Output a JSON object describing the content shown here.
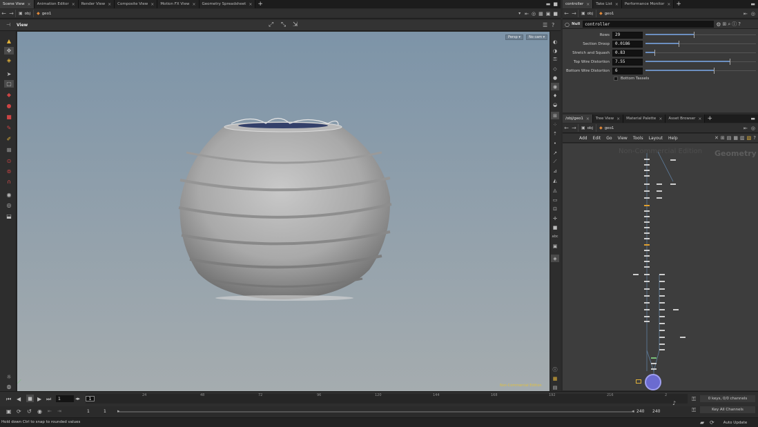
{
  "top_tabs_left": [
    "Scene View",
    "Animation Editor",
    "Render View",
    "Composite View",
    "Motion FX View",
    "Geometry Spreadsheet"
  ],
  "top_tabs_right": [
    "controller",
    "Take List",
    "Performance Monitor"
  ],
  "tab_plus": "+",
  "tab_close": "×",
  "path_left": {
    "obj": "obj",
    "geo": "geo1"
  },
  "path_right": {
    "obj": "obj",
    "geo": "geo1"
  },
  "viewport": {
    "title": "View",
    "persp": "Persp ▾",
    "cam": "No cam ▾",
    "watermark": "Non-Commercial Edition"
  },
  "parm_panel": {
    "node_type": "Null",
    "node_name": "controller",
    "params": [
      {
        "label": "Rows",
        "value": "29",
        "fill": 0.44
      },
      {
        "label": "Section Droop",
        "value": "0.0186",
        "fill": 0.3
      },
      {
        "label": "Stretch and Squash",
        "value": "0.83",
        "fill": 0.08
      },
      {
        "label": "Top Wire Distortion",
        "value": "7.55",
        "fill": 0.76
      },
      {
        "label": "Bottom Wire Distortion",
        "value": "6",
        "fill": 0.62
      }
    ],
    "checkbox_label": "Bottom Tassels"
  },
  "network_tabs": [
    "/obj/geo1",
    "Tree View",
    "Material Palette",
    "Asset Browser"
  ],
  "network_menu": [
    "Add",
    "Edit",
    "Go",
    "View",
    "Tools",
    "Layout",
    "Help"
  ],
  "network_watermark": "Non-Commercial Edition",
  "network_context": "Geometry",
  "timeline": {
    "frame": "1",
    "marker": "1",
    "ticks": [
      "24",
      "48",
      "72",
      "96",
      "120",
      "144",
      "168",
      "192",
      "216",
      "2"
    ],
    "range_start": "1",
    "range_start2": "1",
    "range_end": "240",
    "range_end2": "240",
    "keys_info": "0 keys, 0/0 channels",
    "key_all": "Key All Channels",
    "auto_update": "Auto Update"
  },
  "status": "Hold down Ctrl to snap to rounded values",
  "colors": {
    "accent": "#6c8fc0",
    "viewport_top": "#7d94a8",
    "viewport_bottom": "#a5acaf",
    "node_yellow": "#e0a030"
  }
}
